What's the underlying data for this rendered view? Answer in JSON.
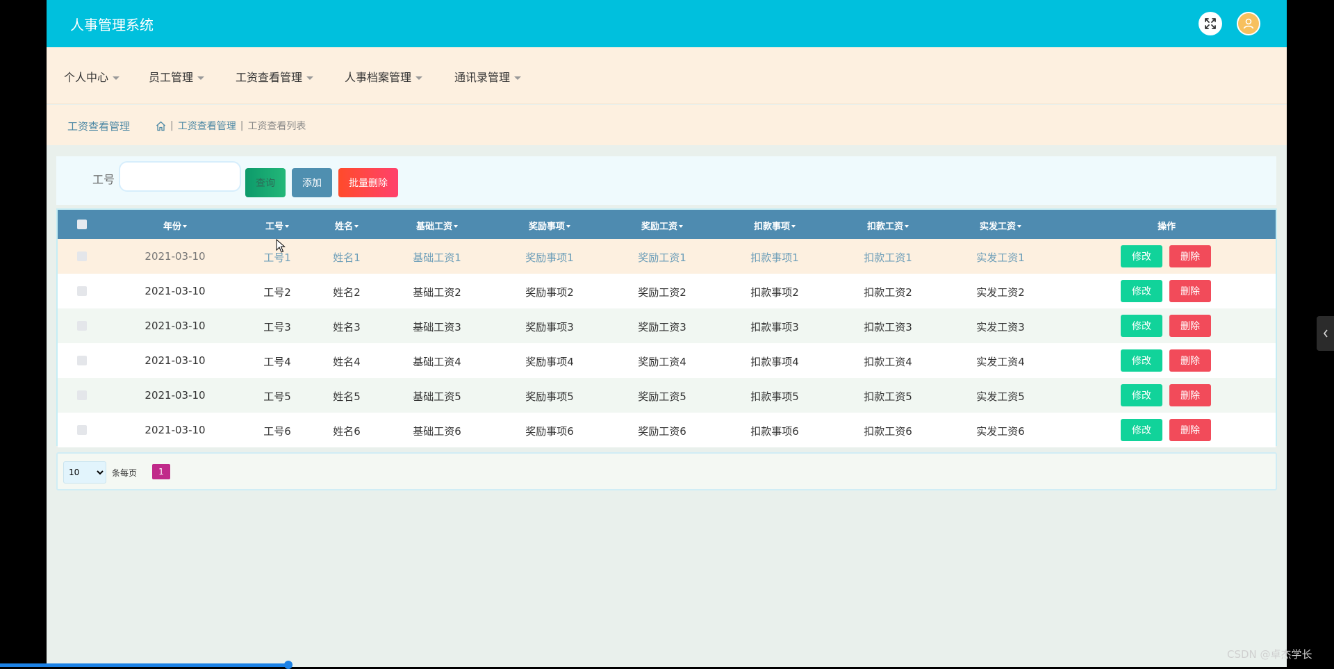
{
  "header": {
    "title": "人事管理系统"
  },
  "menu": [
    {
      "label": "个人中心"
    },
    {
      "label": "员工管理"
    },
    {
      "label": "工资查看管理"
    },
    {
      "label": "人事档案管理"
    },
    {
      "label": "通讯录管理"
    }
  ],
  "breadcrumb": {
    "section_title": "工资查看管理",
    "path": [
      "工资查看管理",
      "工资查看列表"
    ]
  },
  "search": {
    "label": "工号",
    "value": "",
    "search_button": "查询",
    "add_button": "添加",
    "batch_delete_button": "批量删除"
  },
  "table": {
    "columns": [
      "年份",
      "工号",
      "姓名",
      "基础工资",
      "奖励事项",
      "奖励工资",
      "扣款事项",
      "扣款工资",
      "实发工资",
      "操作"
    ],
    "rows": [
      {
        "date": "2021-03-10",
        "id": "工号1",
        "name": "姓名1",
        "base": "基础工资1",
        "reward_item": "奖励事项1",
        "reward": "奖励工资1",
        "deduct_item": "扣款事项1",
        "deduct": "扣款工资1",
        "net": "实发工资1"
      },
      {
        "date": "2021-03-10",
        "id": "工号2",
        "name": "姓名2",
        "base": "基础工资2",
        "reward_item": "奖励事项2",
        "reward": "奖励工资2",
        "deduct_item": "扣款事项2",
        "deduct": "扣款工资2",
        "net": "实发工资2"
      },
      {
        "date": "2021-03-10",
        "id": "工号3",
        "name": "姓名3",
        "base": "基础工资3",
        "reward_item": "奖励事项3",
        "reward": "奖励工资3",
        "deduct_item": "扣款事项3",
        "deduct": "扣款工资3",
        "net": "实发工资3"
      },
      {
        "date": "2021-03-10",
        "id": "工号4",
        "name": "姓名4",
        "base": "基础工资4",
        "reward_item": "奖励事项4",
        "reward": "奖励工资4",
        "deduct_item": "扣款事项4",
        "deduct": "扣款工资4",
        "net": "实发工资4"
      },
      {
        "date": "2021-03-10",
        "id": "工号5",
        "name": "姓名5",
        "base": "基础工资5",
        "reward_item": "奖励事项5",
        "reward": "奖励工资5",
        "deduct_item": "扣款事项5",
        "deduct": "扣款工资5",
        "net": "实发工资5"
      },
      {
        "date": "2021-03-10",
        "id": "工号6",
        "name": "姓名6",
        "base": "基础工资6",
        "reward_item": "奖励事项6",
        "reward": "奖励工资6",
        "deduct_item": "扣款事项6",
        "deduct": "扣款工资6",
        "net": "实发工资6"
      }
    ],
    "edit_label": "修改",
    "delete_label": "删除"
  },
  "pagination": {
    "page_size": "10",
    "per_page_label": "条每页",
    "current_page": "1"
  },
  "watermark": "CSDN @卓杰学长",
  "colors": {
    "topbar": "#00c0dd",
    "menubar": "#fdf0e0",
    "table_header": "#4e8bb0",
    "edit": "#11d39a",
    "delete": "#f24b5a",
    "current_page": "#c02a8a"
  },
  "icons": [
    "fullscreen-icon",
    "user-avatar-icon",
    "home-icon",
    "chevron-left-icon",
    "back-to-top-icon"
  ]
}
